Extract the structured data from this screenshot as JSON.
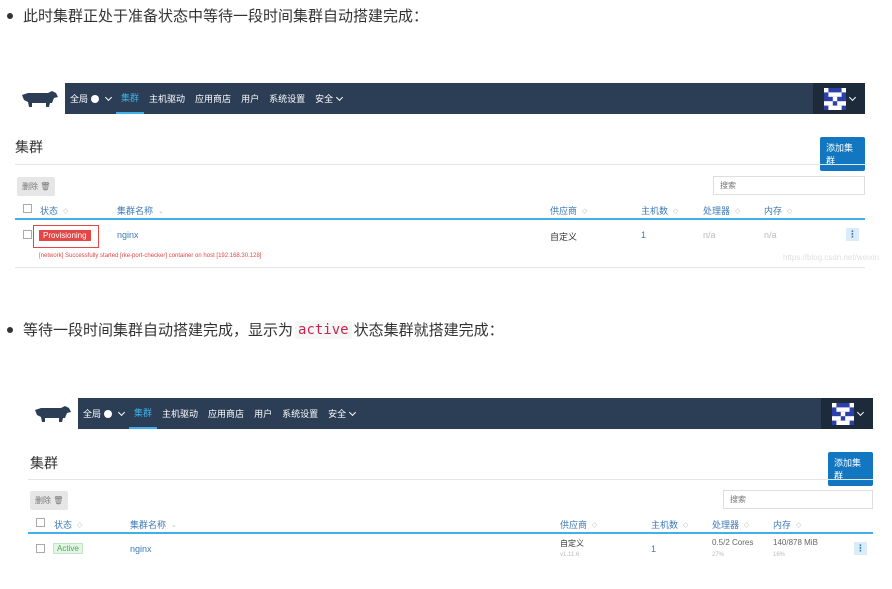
{
  "paragraphs": {
    "first": "此时集群正处于准备状态中等待一段时间集群自动搭建完成：",
    "second_before": "等待一段时间集群自动搭建完成，显示为",
    "second_code": "active",
    "second_after": "状态集群就搭建完成："
  },
  "nav": {
    "global": "全局",
    "items": [
      "集群",
      "主机驱动",
      "应用商店",
      "用户",
      "系统设置",
      "安全"
    ]
  },
  "page": {
    "title": "集群",
    "add_button": "添加集群",
    "delete_button": "删除",
    "search_placeholder": "搜索"
  },
  "columns": [
    "状态",
    "集群名称",
    "供应商",
    "主机数",
    "处理器",
    "内存"
  ],
  "screenshot1": {
    "row": {
      "status": "Provisioning",
      "name": "nginx",
      "provider": "自定义",
      "hosts": "1",
      "cpu": "n/a",
      "memory": "n/a",
      "message": "[network] Successfully started [rke-port-checker] container on host [192.168.30.128]"
    },
    "watermark": "https://blog.csdn.net/weixin"
  },
  "screenshot2": {
    "row": {
      "status": "Active",
      "name": "nginx",
      "provider": "自定义",
      "provider_sub": "v1.11.6",
      "hosts": "1",
      "cpu": "0.5/2 Cores",
      "cpu_sub": "27%",
      "memory": "140/878 MiB",
      "memory_sub": "16%"
    }
  },
  "colors": {
    "topbar": "#2c3e55",
    "accent": "#3fb0e8",
    "primary_button": "#1277c0",
    "provisioning": "#e64545",
    "active": "#4aaa4e"
  },
  "icons": [
    "bullet-dot",
    "cow-logo-icon",
    "globe-icon",
    "chevron-down-icon",
    "pixel-avatar-icon",
    "trash-icon",
    "sort-icon",
    "kebab-menu-icon"
  ]
}
